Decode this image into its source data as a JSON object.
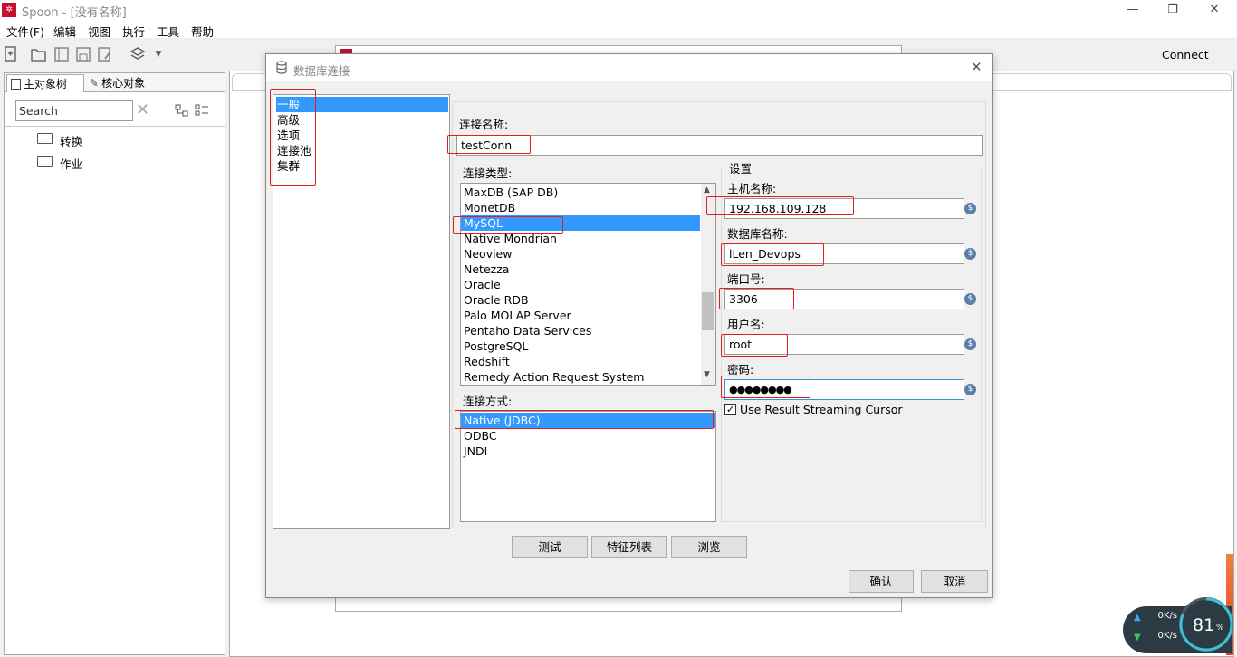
{
  "app": {
    "icon": "spoon-app-icon",
    "title": "Spoon - [没有名称]"
  },
  "window_controls": {
    "minimize": "—",
    "restore": "❐",
    "close": "✕"
  },
  "menu": [
    "文件(F)",
    "编辑",
    "视图",
    "执行",
    "工具",
    "帮助"
  ],
  "toolbar": {
    "connect_label": "Connect"
  },
  "left_panel": {
    "tabs": [
      "主对象树",
      "核心对象"
    ],
    "search_value": "Search",
    "tree": [
      "转换",
      "作业"
    ]
  },
  "dialog": {
    "title": "数据库连接",
    "categories": [
      "一般",
      "高级",
      "选项",
      "连接池",
      "集群"
    ],
    "selected_category": "一般",
    "connection_name_label": "连接名称:",
    "connection_name_value": "testConn",
    "connection_type_label": "连接类型:",
    "connection_types": [
      "MaxDB (SAP DB)",
      "MonetDB",
      "MySQL",
      "Native Mondrian",
      "Neoview",
      "Netezza",
      "Oracle",
      "Oracle RDB",
      "Palo MOLAP Server",
      "Pentaho Data Services",
      "PostgreSQL",
      "Redshift",
      "Remedy Action Request System"
    ],
    "selected_type": "MySQL",
    "access_label": "连接方式:",
    "access_methods": [
      "Native (JDBC)",
      "ODBC",
      "JNDI"
    ],
    "selected_access": "Native (JDBC)",
    "settings_label": "设置",
    "host_label": "主机名称:",
    "host_value": "192.168.109.128",
    "db_label": "数据库名称:",
    "db_value": "lLen_Devops",
    "port_label": "端口号:",
    "port_value": "3306",
    "user_label": "用户名:",
    "user_value": "root",
    "password_label": "密码:",
    "password_value": "●●●●●●●●",
    "streaming_label": "Use Result Streaming Cursor",
    "streaming_checked": true,
    "buttons": {
      "test": "测试",
      "features": "特征列表",
      "explore": "浏览",
      "ok": "确认",
      "cancel": "取消"
    }
  },
  "net_widget": {
    "up": "0K/s",
    "down": "0K/s",
    "percent": "81",
    "unit": "%"
  }
}
